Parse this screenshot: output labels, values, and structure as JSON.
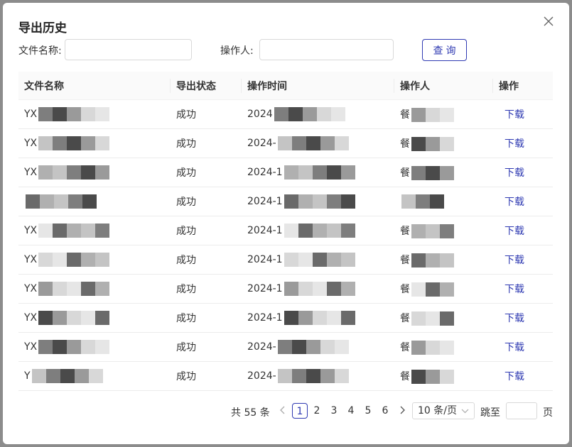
{
  "dialog": {
    "title": "导出历史"
  },
  "filters": {
    "file_name_label": "文件名称:",
    "operator_label": "操作人:",
    "file_name_value": "",
    "operator_value": "",
    "query_label": "查询"
  },
  "table": {
    "headers": [
      "文件名称",
      "导出状态",
      "操作时间",
      "操作人",
      "操作"
    ],
    "rows": [
      {
        "file": "YX",
        "status": "成功",
        "time": "2024",
        "operator": "餐",
        "action": "下载"
      },
      {
        "file": "YX",
        "status": "成功",
        "time": "2024-",
        "operator": "餐",
        "action": "下载"
      },
      {
        "file": "YX",
        "status": "成功",
        "time": "2024-1",
        "operator": "餐",
        "action": "下载"
      },
      {
        "file": "",
        "status": "成功",
        "time": "2024-1",
        "operator": "",
        "action": "下载"
      },
      {
        "file": "YX",
        "status": "成功",
        "time": "2024-1",
        "operator": "餐",
        "action": "下载"
      },
      {
        "file": "YX",
        "status": "成功",
        "time": "2024-1",
        "operator": "餐",
        "action": "下载"
      },
      {
        "file": "YX",
        "status": "成功",
        "time": "2024-1",
        "operator": "餐",
        "action": "下载"
      },
      {
        "file": "YX",
        "status": "成功",
        "time": "2024-1",
        "operator": "餐",
        "action": "下载"
      },
      {
        "file": "YX",
        "status": "成功",
        "time": "2024-",
        "operator": "餐",
        "action": "下载"
      },
      {
        "file": "Y",
        "status": "成功",
        "time": "2024-",
        "operator": "餐",
        "action": "下载"
      }
    ]
  },
  "pagination": {
    "total_text": "共 55 条",
    "prev_icon": "chevron-left-icon",
    "next_icon": "chevron-right-icon",
    "pages": [
      "1",
      "2",
      "3",
      "4",
      "5",
      "6"
    ],
    "current_page": "1",
    "page_size_label": "10 条/页",
    "jump_label": "跳至",
    "jump_value": "",
    "page_unit": "页"
  },
  "colors": {
    "accent": "#2f3ab2",
    "overlay": "#8c8c8c",
    "header_bg": "#fafafa"
  }
}
